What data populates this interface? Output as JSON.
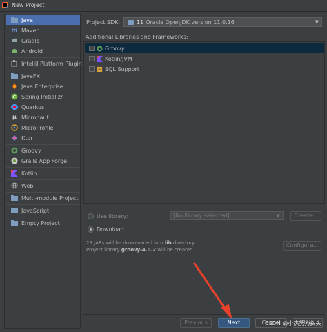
{
  "window": {
    "title": "New Project"
  },
  "sidebar": {
    "items": [
      {
        "label": "Java",
        "icon": "folder-icon",
        "selected": true
      },
      {
        "label": "Maven",
        "icon": "maven-icon"
      },
      {
        "label": "Gradle",
        "icon": "gradle-icon"
      },
      {
        "label": "Android",
        "icon": "android-icon"
      },
      {
        "label": "IntelliJ Platform Plugin",
        "icon": "plugin-icon"
      },
      {
        "label": "JavaFX",
        "icon": "folder-icon"
      },
      {
        "label": "Java Enterprise",
        "icon": "java-enterprise-icon"
      },
      {
        "label": "Spring Initializr",
        "icon": "spring-icon"
      },
      {
        "label": "Quarkus",
        "icon": "quarkus-icon"
      },
      {
        "label": "Micronaut",
        "icon": "micronaut-icon"
      },
      {
        "label": "MicroProfile",
        "icon": "microprofile-icon"
      },
      {
        "label": "Ktor",
        "icon": "ktor-icon"
      },
      {
        "label": "Groovy",
        "icon": "groovy-icon"
      },
      {
        "label": "Grails App Forge",
        "icon": "grails-icon"
      },
      {
        "label": "Kotlin",
        "icon": "kotlin-icon"
      },
      {
        "label": "Web",
        "icon": "web-icon"
      },
      {
        "label": "Multi-module Project",
        "icon": "folder-icon"
      },
      {
        "label": "JavaScript",
        "icon": "folder-icon"
      },
      {
        "label": "Empty Project",
        "icon": "folder-icon"
      }
    ]
  },
  "sdk": {
    "label": "Project SDK:",
    "version_num": "11",
    "version_text": "Oracle OpenJDK version 11.0.16"
  },
  "libraries": {
    "label": "Additional Libraries and Frameworks:",
    "items": [
      {
        "label": "Groovy",
        "icon": "groovy-icon",
        "selected": true
      },
      {
        "label": "Kotlin/JVM",
        "icon": "kotlin-icon"
      },
      {
        "label": "SQL Support",
        "icon": "database-icon"
      }
    ]
  },
  "library_options": {
    "use_library_label": "Use library:",
    "library_placeholder": "[No library selected]",
    "create_label": "Create...",
    "download_label": "Download",
    "info_line1_pre": "29 JARs will be downloaded into ",
    "info_line1_bold": "lib",
    "info_line1_post": " directory",
    "info_line2_pre": "Project library ",
    "info_line2_bold": "groovy-4.0.2",
    "info_line2_post": " will be created",
    "configure_label": "Configure..."
  },
  "footer": {
    "previous_label": "Previous",
    "next_label": "Next",
    "cancel_label": "Cancel",
    "help_label": "Help"
  },
  "watermark": {
    "text": "CSDN @小杰努力头头"
  },
  "colors": {
    "selection": "#4b6eaf",
    "primary_button": "#365880",
    "arrow": "#e8412c"
  }
}
